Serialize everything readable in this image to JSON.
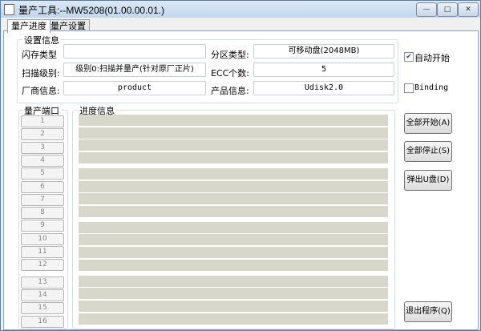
{
  "window": {
    "title": "量产工具:--MW5208(01.00.00.01.)",
    "minimize": "—",
    "maximize": "□",
    "close": "✕"
  },
  "tabs": [
    {
      "label": "量产进度",
      "active": true
    },
    {
      "label": "量产设置",
      "active": false
    }
  ],
  "settings": {
    "group_label": "设置信息",
    "flash_type": {
      "label": "闪存类型",
      "value": ""
    },
    "scan_level": {
      "label": "扫描级别:",
      "value": "级别0:扫描并量产(针对原厂正片)"
    },
    "vendor_info": {
      "label": "厂商信息:",
      "value": "product"
    },
    "partition_type": {
      "label": "分区类型:",
      "value": "可移动盘(2048MB)"
    },
    "ecc_count": {
      "label": "ECC个数:",
      "value": "5"
    },
    "product_info": {
      "label": "产品信息:",
      "value": "Udisk2.0"
    }
  },
  "options": {
    "auto_start": {
      "label": "自动开始",
      "checked": true
    },
    "binding": {
      "label": "Binding",
      "checked": false
    }
  },
  "ports": {
    "group_label": "量产端口",
    "items": [
      "1",
      "2",
      "3",
      "4",
      "5",
      "6",
      "7",
      "8",
      "9",
      "10",
      "11",
      "12",
      "13",
      "14",
      "15",
      "16"
    ]
  },
  "progress": {
    "group_label": "进度信息"
  },
  "buttons": {
    "start_all": "全部开始(A)",
    "stop_all": "全部停止(S)",
    "eject": "弹出U盘(D)",
    "exit": "退出程序(Q)"
  }
}
